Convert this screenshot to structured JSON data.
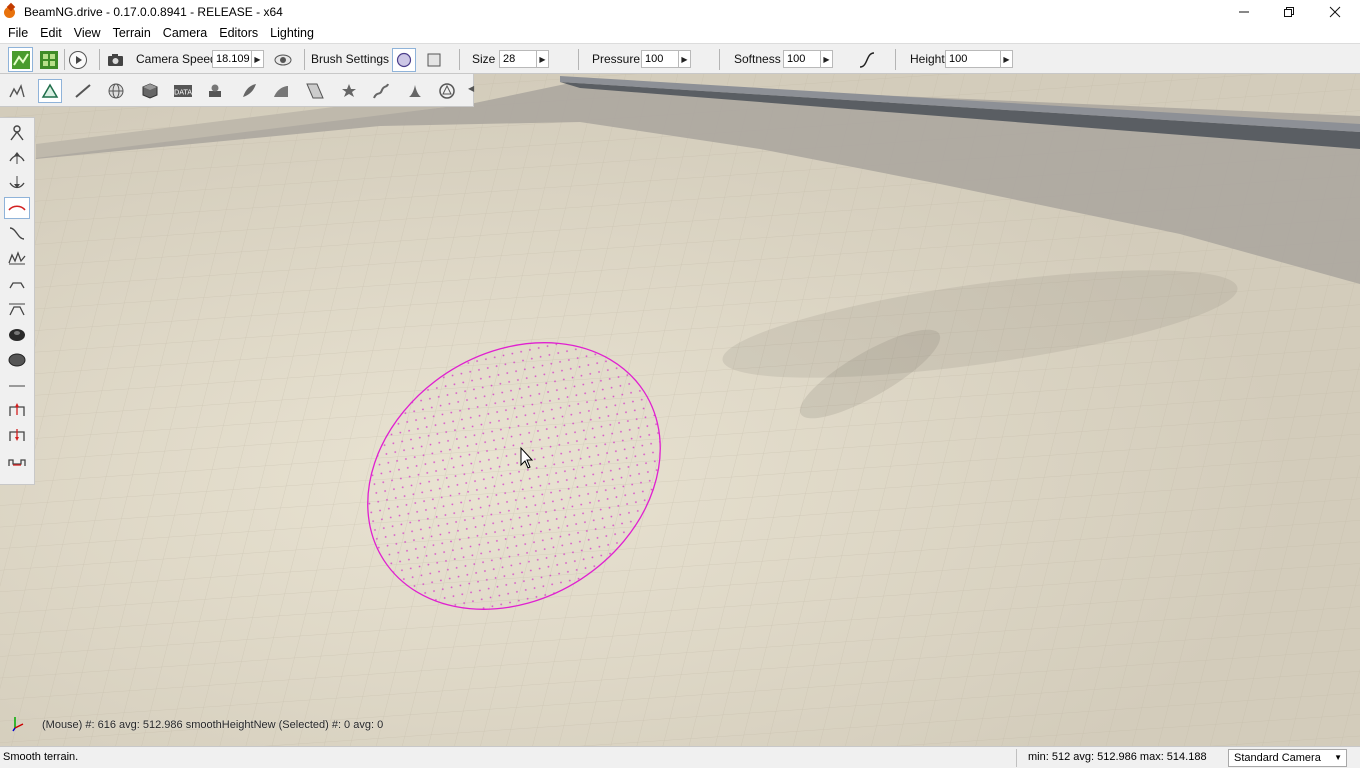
{
  "window": {
    "title": "BeamNG.drive - 0.17.0.0.8941 - RELEASE - x64",
    "minimize": "—",
    "maximize": "❐",
    "close": "✕"
  },
  "menu": [
    "File",
    "Edit",
    "View",
    "Terrain",
    "Camera",
    "Editors",
    "Lighting"
  ],
  "toolbar": {
    "camera_speed_label": "Camera Speed",
    "camera_speed_value": "18.109",
    "brush_settings_label": "Brush Settings",
    "size_label": "Size",
    "size_value": "28",
    "pressure_label": "Pressure",
    "pressure_value": "100",
    "softness_label": "Softness",
    "softness_value": "100",
    "height_label": "Height",
    "height_value": "100"
  },
  "viewport": {
    "info_line": "(Mouse) #: 616  avg: 512.986 smoothHeightNew  (Selected) #: 0  avg: 0",
    "brush_color": "#e020d0"
  },
  "status": {
    "text": "Smooth terrain.",
    "stats": "min: 512  avg: 512.986  max: 514.188",
    "camera": "Standard Camera"
  },
  "icons": {
    "toolbar_row2": [
      "terrain-tools-icon",
      "terrain-painter-icon",
      "road-editor-icon",
      "world-editor-icon",
      "object-icon",
      "datablock-icon",
      "material-icon",
      "forest-icon",
      "river-icon",
      "mesh-road-icon",
      "decal-icon",
      "sketch-icon",
      "particle-icon",
      "navmesh-icon"
    ],
    "left_tools": [
      "grab-terrain-icon",
      "raise-height-icon",
      "lower-height-icon",
      "smooth-height-icon",
      "smooth-slope-icon",
      "paint-noise-icon",
      "flatten-icon",
      "set-height-icon",
      "set-empty-icon",
      "clear-empty-icon",
      "divider",
      "alpha-brush-a-icon",
      "alpha-brush-b-icon",
      "alpha-brush-c-icon"
    ]
  }
}
